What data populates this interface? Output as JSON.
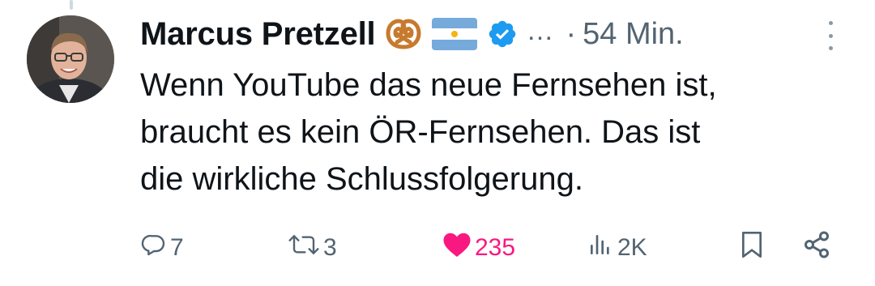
{
  "tweet": {
    "author": {
      "display_name": "Marcus Pretzell",
      "emojis": [
        "pretzel-emoji",
        "argentina-flag-emoji"
      ],
      "verified": true,
      "handle_truncated": "…"
    },
    "separator": "·",
    "timestamp": "54 Min.",
    "text": "Wenn YouTube das neue Fernsehen ist,\nbraucht es kein ÖR-Fernsehen. Das ist\ndie wirkliche Schlussfolgerung.",
    "actions": {
      "replies": "7",
      "reposts": "3",
      "likes": "235",
      "views": "2K"
    },
    "colors": {
      "verified": "#1d9bf0",
      "like_active": "#f91880",
      "muted": "#536471"
    }
  }
}
